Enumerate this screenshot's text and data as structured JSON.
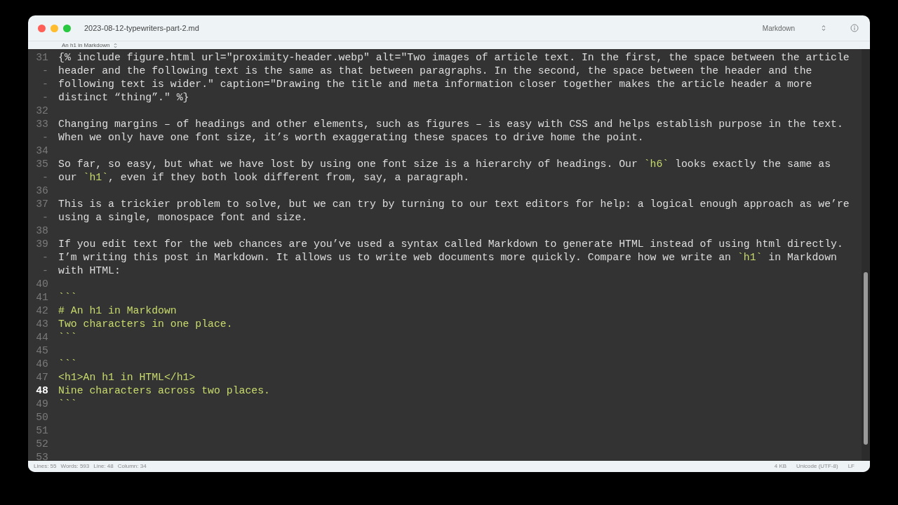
{
  "window": {
    "title": "2023-08-12-typewriters-part-2.md",
    "symbol_menu": "An h1 in Markdown",
    "syntax": "Markdown"
  },
  "continuation_mark": "-",
  "lines": [
    {
      "number": "31",
      "current": false,
      "rows": [
        {
          "parts": [
            {
              "kind": "plain",
              "text": "{% include figure.html url=\"proximity-header.webp\" alt=\"Two images of article text. In the first, the space between the article"
            }
          ]
        },
        {
          "parts": [
            {
              "kind": "plain",
              "text": "header and the following text is the same as that between paragraphs. In the second, the space between the header and the"
            }
          ]
        },
        {
          "parts": [
            {
              "kind": "plain",
              "text": "following text is wider.\" caption=\"Drawing the title and meta information closer together makes the article header a more"
            }
          ]
        },
        {
          "parts": [
            {
              "kind": "plain",
              "text": "distinct “thing”.\" %}"
            }
          ]
        }
      ]
    },
    {
      "number": "32",
      "current": false
    },
    {
      "number": "33",
      "current": false,
      "rows": [
        {
          "parts": [
            {
              "kind": "plain",
              "text": "Changing margins – of headings and other elements, such as figures – is easy with CSS and helps establish purpose in the text."
            }
          ]
        },
        {
          "parts": [
            {
              "kind": "plain",
              "text": "When we only have one font size, it’s worth exaggerating these spaces to drive home the point."
            }
          ]
        }
      ]
    },
    {
      "number": "34",
      "current": false
    },
    {
      "number": "35",
      "current": false,
      "rows": [
        {
          "parts": [
            {
              "kind": "plain",
              "text": "So far, so easy, but what we have lost by using one font size is a hierarchy of headings. Our "
            },
            {
              "kind": "code",
              "text": "`h6`"
            },
            {
              "kind": "plain",
              "text": " looks exactly the same as"
            }
          ]
        },
        {
          "parts": [
            {
              "kind": "plain",
              "text": "our "
            },
            {
              "kind": "code",
              "text": "`h1`"
            },
            {
              "kind": "plain",
              "text": ", even if they both look different from, say, a paragraph."
            }
          ]
        }
      ]
    },
    {
      "number": "36",
      "current": false
    },
    {
      "number": "37",
      "current": false,
      "rows": [
        {
          "parts": [
            {
              "kind": "plain",
              "text": "This is a trickier problem to solve, but we can try by turning to our text editors for help: a logical enough approach as we’re"
            }
          ]
        },
        {
          "parts": [
            {
              "kind": "plain",
              "text": "using a single, monospace font and size."
            }
          ]
        }
      ]
    },
    {
      "number": "38",
      "current": false
    },
    {
      "number": "39",
      "current": false,
      "rows": [
        {
          "parts": [
            {
              "kind": "plain",
              "text": "If you edit text for the web chances are you’ve used a syntax called Markdown to generate HTML instead of using html directly."
            }
          ]
        },
        {
          "parts": [
            {
              "kind": "plain",
              "text": "I’m writing this post in Markdown. It allows us to write web documents more quickly. Compare how we write an "
            },
            {
              "kind": "code",
              "text": "`h1`"
            },
            {
              "kind": "plain",
              "text": " in Markdown"
            }
          ]
        },
        {
          "parts": [
            {
              "kind": "plain",
              "text": "with HTML:"
            }
          ]
        }
      ]
    },
    {
      "number": "40",
      "current": false
    },
    {
      "number": "41",
      "current": false,
      "rows": [
        {
          "parts": [
            {
              "kind": "code",
              "text": "```"
            }
          ]
        }
      ]
    },
    {
      "number": "42",
      "current": false,
      "rows": [
        {
          "parts": [
            {
              "kind": "code",
              "text": "# An h1 in Markdown"
            }
          ]
        }
      ]
    },
    {
      "number": "43",
      "current": false,
      "rows": [
        {
          "parts": [
            {
              "kind": "code",
              "text": "Two characters in one place."
            }
          ]
        }
      ]
    },
    {
      "number": "44",
      "current": false,
      "rows": [
        {
          "parts": [
            {
              "kind": "code",
              "text": "```"
            }
          ]
        }
      ]
    },
    {
      "number": "45",
      "current": false
    },
    {
      "number": "46",
      "current": false,
      "rows": [
        {
          "parts": [
            {
              "kind": "code",
              "text": "```"
            }
          ]
        }
      ]
    },
    {
      "number": "47",
      "current": false,
      "rows": [
        {
          "parts": [
            {
              "kind": "code",
              "text": "<h1>An h1 in HTML</h1>"
            }
          ]
        }
      ]
    },
    {
      "number": "48",
      "current": true,
      "rows": [
        {
          "parts": [
            {
              "kind": "code",
              "text": "Nine characters across two places."
            }
          ]
        }
      ]
    },
    {
      "number": "49",
      "current": false,
      "rows": [
        {
          "parts": [
            {
              "kind": "code",
              "text": "```"
            }
          ]
        }
      ]
    },
    {
      "number": "50",
      "current": false
    },
    {
      "number": "51",
      "current": false
    },
    {
      "number": "52",
      "current": false
    },
    {
      "number": "53",
      "current": false
    }
  ],
  "status_bar": {
    "left": [
      "Lines: 55",
      "Words: 593",
      "Line: 48",
      "Column: 34"
    ],
    "right": [
      "4 KB",
      "Unicode (UTF-8)",
      "LF"
    ]
  }
}
